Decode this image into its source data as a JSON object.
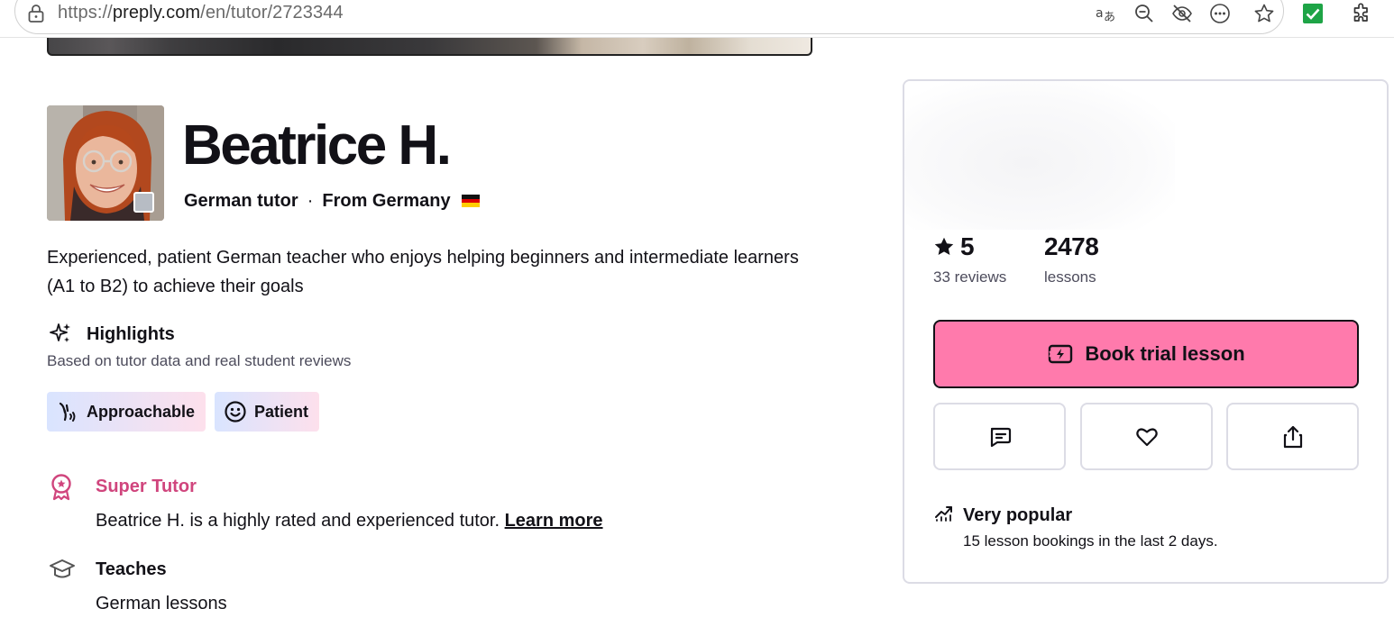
{
  "browser": {
    "url_prefix": "https://",
    "url_host": "preply.com",
    "url_path": "/en/tutor/2723344",
    "toolbar_icons": [
      "translate-icon",
      "zoom-out-icon",
      "tracking-prevention-icon",
      "more-options-icon",
      "favorite-star-icon",
      "extension-checkmark-icon",
      "extensions-puzzle-icon"
    ],
    "extension_accent": "#1ea446"
  },
  "profile": {
    "name": "Beatrice H.",
    "role": "German tutor",
    "separator": "·",
    "origin": "From Germany",
    "description": "Experienced, patient German teacher who enjoys helping beginners and intermediate learners (A1 to B2) to achieve their goals"
  },
  "highlights": {
    "title": "Highlights",
    "subtitle": "Based on tutor data and real student reviews",
    "chips": [
      {
        "label": "Approachable",
        "icon": "wave-hand-icon"
      },
      {
        "label": "Patient",
        "icon": "smiley-icon"
      }
    ]
  },
  "super_tutor": {
    "title": "Super Tutor",
    "text": "Beatrice H. is a highly rated and experienced tutor. ",
    "link": "Learn more",
    "accent": "#d0457d"
  },
  "teaches": {
    "title": "Teaches",
    "text": "German lessons"
  },
  "booking": {
    "rating_value": "5",
    "rating_label": "33 reviews",
    "lessons_value": "2478",
    "lessons_label": "lessons",
    "book_label": "Book trial lesson",
    "book_color": "#ff7aac",
    "actions": [
      "message-icon",
      "heart-icon",
      "share-icon"
    ],
    "popular_title": "Very popular",
    "popular_text": "15 lesson bookings in the last 2 days."
  }
}
